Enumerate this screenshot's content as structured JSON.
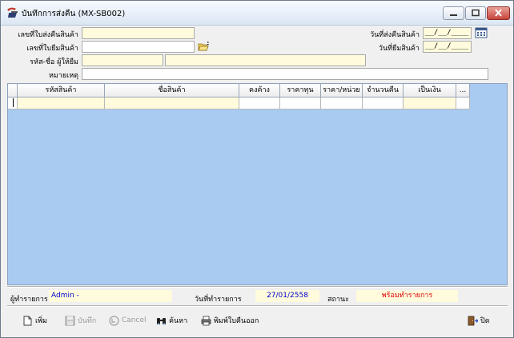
{
  "window": {
    "title": "บันทึกการส่งคืน (MX-SB002)",
    "minimize_glyph": "—",
    "maximize_glyph": "□",
    "close_glyph": "✕"
  },
  "header": {
    "return_doc_label": "เลขที่ใบส่งคืนสินค้า",
    "borrow_doc_label": "เลขที่ใบยืมสินค้า",
    "borrower_label": "รหัส-ชื่อ ผู้ให้ยืม",
    "note_label": "หมายเหตุ",
    "return_date_label": "วันที่ส่งคืนสินค้า",
    "borrow_date_label": "วันที่ยืมสินค้า",
    "return_date_value": "__/__/____",
    "borrow_date_value": "__/__/____"
  },
  "grid": {
    "columns": [
      "รหัสสินค้า",
      "ชื่อสินค้า",
      "คงค้าง",
      "ราคาทุน",
      "ราคา/หน่วย",
      "จำนวนคืน",
      "เป็นเงิน",
      "..."
    ]
  },
  "footer": {
    "user_label": "ผู้ทำรายการ",
    "user_value": "Admin -",
    "date_label": "วันที่ทำรายการ",
    "date_value": "27/01/2558",
    "status_label": "สถานะ",
    "status_value": "พร้อมทำรายการ"
  },
  "toolbar": {
    "add_label": "เพิ่ม",
    "save_label": "บันทึก",
    "cancel_label": "Cancel",
    "search_label": "ค้นหา",
    "print_label": "พิมพ์ใบคืนออก",
    "close_label": "ปิด"
  },
  "colors": {
    "grid_background": "#a9cbf2",
    "input_highlight": "#fffbdc",
    "date_value_color": "#0000cc",
    "status_value_color": "#e00000"
  }
}
